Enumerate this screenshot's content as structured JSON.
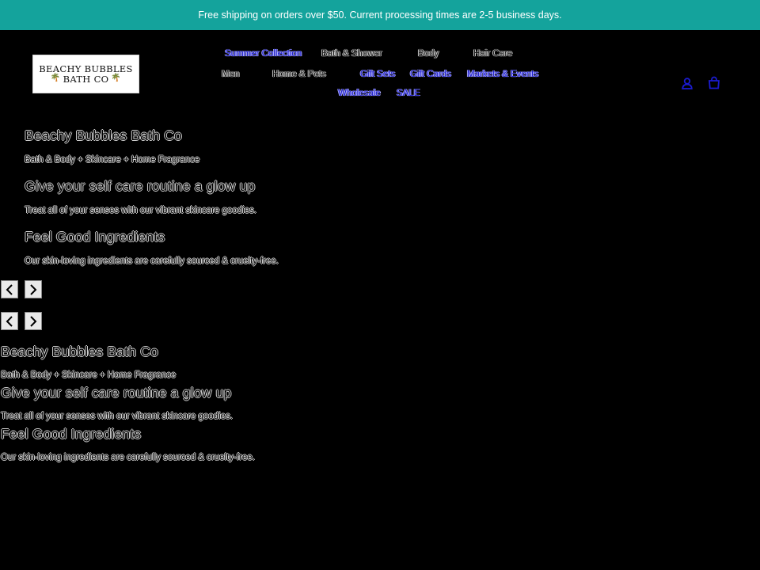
{
  "announcement": "Free shipping on orders over $50. Current processing times are 2-5 business days.",
  "logo": {
    "line1": "BEACHY BUBBLES",
    "line2": "BATH CO"
  },
  "nav": [
    {
      "label": "Summer Collection"
    },
    {
      "label": "Bath & Shower"
    },
    {
      "label": "Body"
    },
    {
      "label": "Hair Care"
    },
    {
      "label": "Men"
    },
    {
      "label": "Home & Pets"
    },
    {
      "label": "Gift Sets"
    },
    {
      "label": "Gift Cards"
    },
    {
      "label": "Markets & Events"
    },
    {
      "label": "Wholesale"
    },
    {
      "label": "SALE"
    }
  ],
  "header_icons": [
    "account-icon",
    "cart-icon"
  ],
  "colors": {
    "announcement_bg": "#14a39c",
    "accent_link": "#1b1bd0",
    "page_bg": "#000000"
  },
  "slideshow_1": {
    "title": "Beachy Bubbles Bath Co",
    "subtitle": "Bath & Body + Skincare + Home Fragrance",
    "heading2": "Give your self care routine a glow up",
    "text2": "Treat all of your senses with our vibrant skincare goodies.",
    "heading3": "Feel Good Ingredients",
    "text3": "Our skin-loving ingredients are carefully sourced & cruelty-free.",
    "prev_label": "‹",
    "next_label": "›"
  },
  "slideshow_2": {
    "prev_label": "‹",
    "next_label": "›",
    "title": "Beachy Bubbles Bath Co",
    "subtitle": "Bath & Body + Skincare + Home Fragrance",
    "heading2": "Give your self care routine a glow up",
    "text2": "Treat all of your senses with our vibrant skincare goodies.",
    "heading3": "Feel Good Ingredients",
    "text3": "Our skin-loving ingredients are carefully sourced & cruelty-free."
  }
}
